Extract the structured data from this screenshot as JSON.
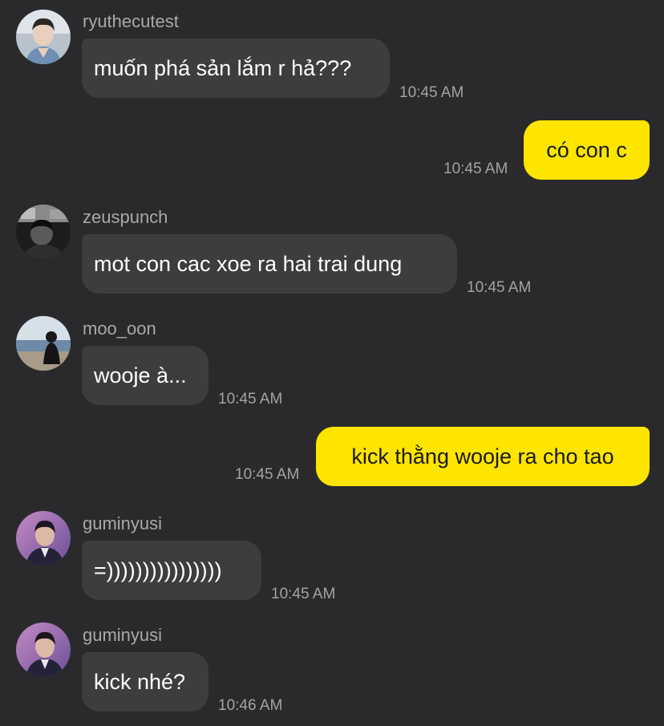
{
  "messages": [
    {
      "type": "incoming",
      "sender": "ryuthecutest",
      "avatar": "person-avatar-icon",
      "text": "muốn phá sản lắm r hả???",
      "time": "10:45 AM"
    },
    {
      "type": "outgoing",
      "text": "có con c",
      "time": "10:45 AM"
    },
    {
      "type": "incoming",
      "sender": "zeuspunch",
      "avatar": "person-avatar-icon",
      "text": "mot con cac xoe ra hai trai dung",
      "time": "10:45 AM"
    },
    {
      "type": "incoming",
      "sender": "moo_oon",
      "avatar": "beach-avatar-icon",
      "text": "wooje à...",
      "time": "10:45 AM"
    },
    {
      "type": "outgoing",
      "text": "kick thằng wooje ra cho tao",
      "time": "10:45 AM"
    },
    {
      "type": "incoming",
      "sender": "guminyusi",
      "avatar": "person-avatar-icon",
      "text": "=))))))))))))))))",
      "time": "10:45 AM"
    },
    {
      "type": "incoming",
      "sender": "guminyusi",
      "avatar": "person-avatar-icon",
      "text": "kick nhé?",
      "time": "10:46 AM"
    }
  ],
  "colors": {
    "background": "#2a2a2c",
    "incoming_bubble": "#3d3d3f",
    "outgoing_bubble": "#fee500",
    "secondary_text": "#a9a9ab"
  }
}
